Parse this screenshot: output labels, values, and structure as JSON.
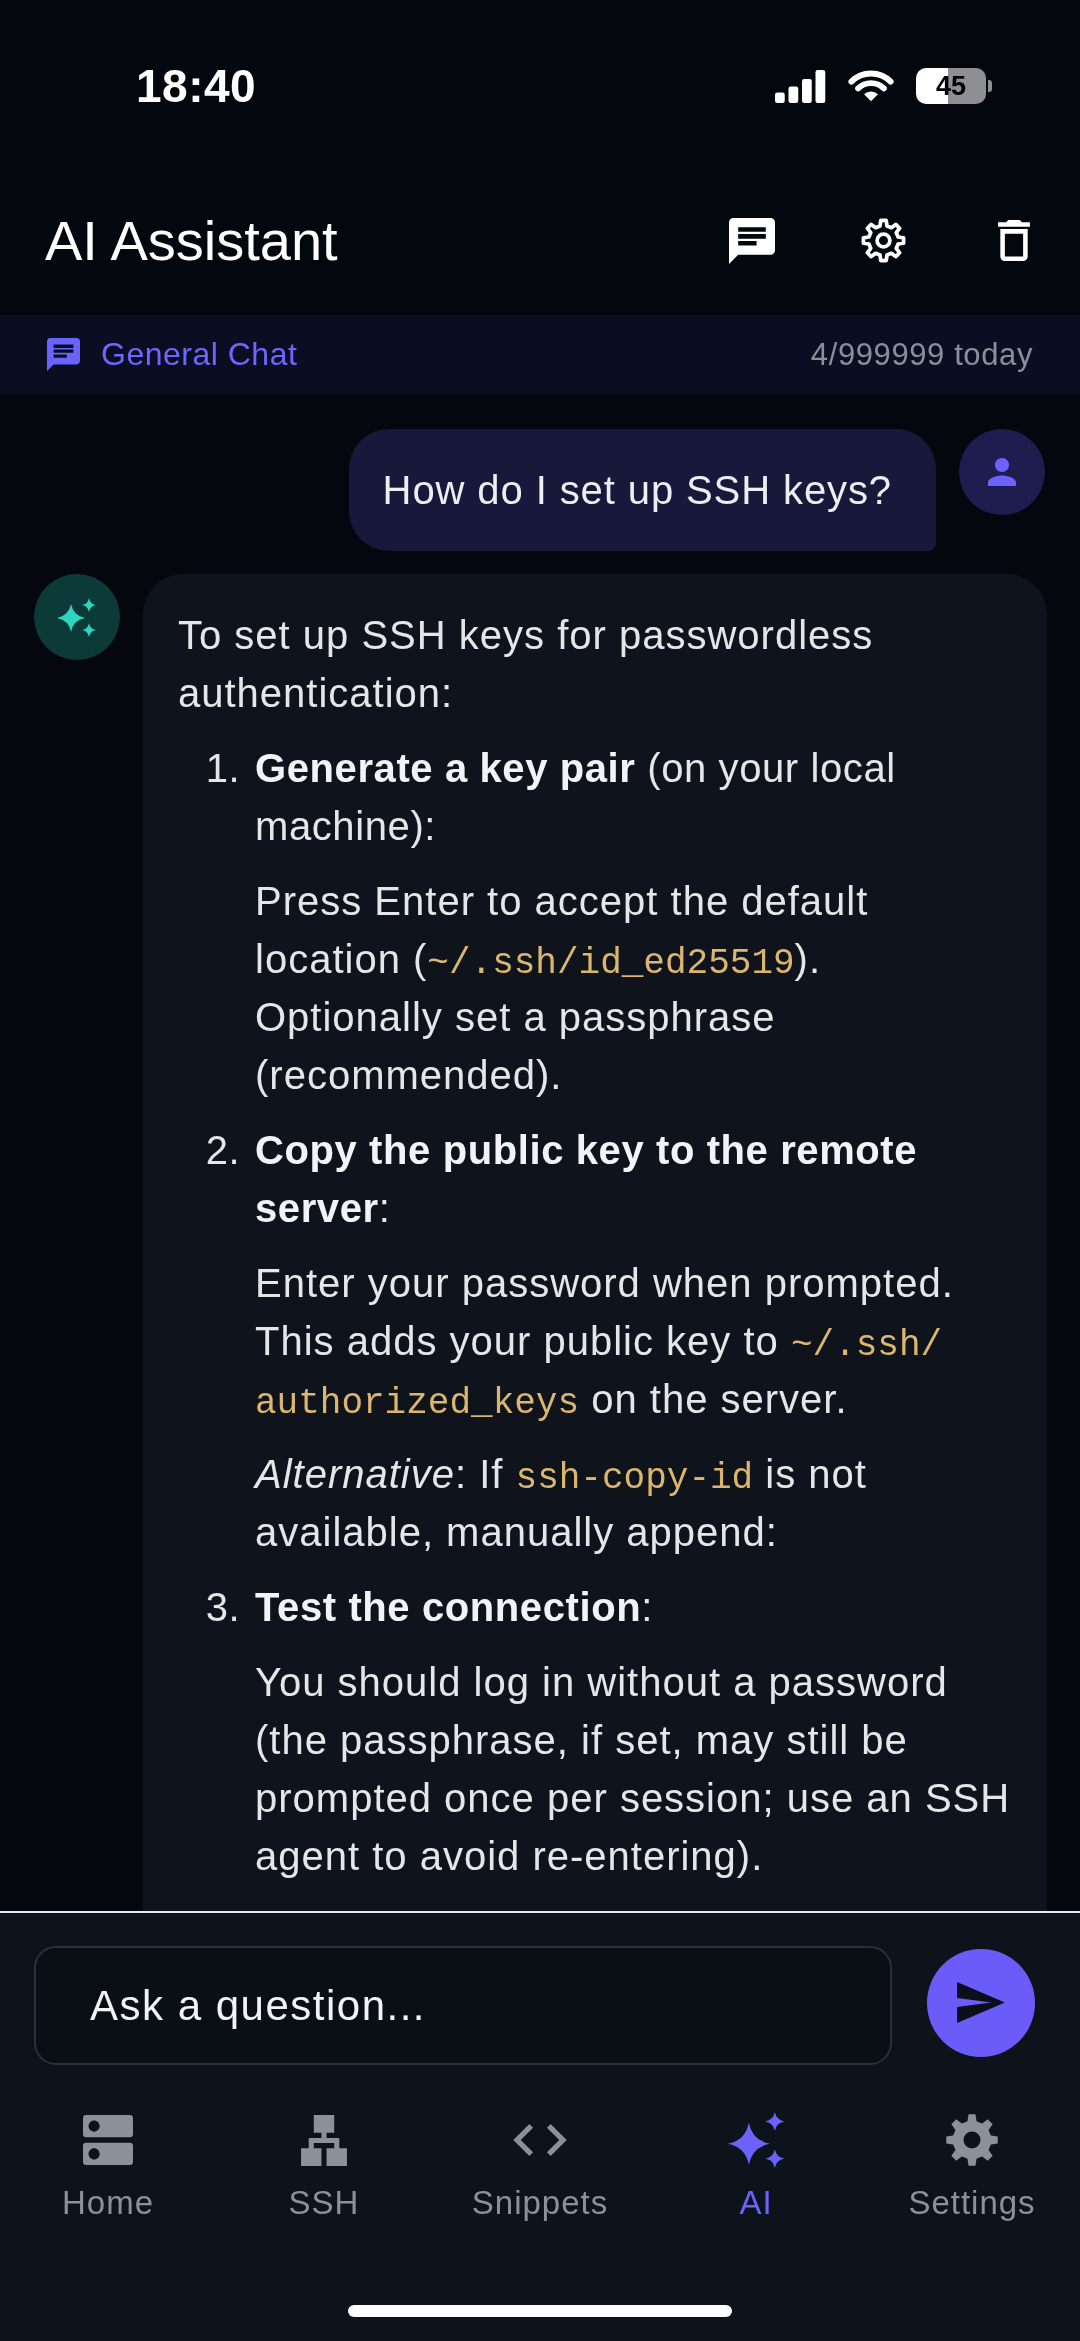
{
  "status_bar": {
    "time": "18:40",
    "battery": "45"
  },
  "header": {
    "title": "AI Assistant"
  },
  "chat_banner": {
    "name": "General Chat",
    "usage": "4/999999 today"
  },
  "messages": [
    {
      "kind": "user",
      "text": "How do I set up SSH keys?"
    },
    {
      "kind": "assistant",
      "intro": "To set up SSH keys for passwordless authentication:",
      "steps": [
        {
          "number": "1.",
          "title": "**Generate a key pair** (on your local machine):",
          "paragraphs": [
            [
              {
                "kind": "text",
                "text": "Press Enter to accept the default location ("
              },
              {
                "kind": "code",
                "text": "~/.ssh/id_ed25519"
              },
              {
                "kind": "text",
                "text": "). Optionally set a passphrase (recommended)."
              }
            ]
          ]
        },
        {
          "number": "2.",
          "title": "**Copy the public key to the remote server**:",
          "paragraphs": [
            [
              {
                "kind": "text",
                "text": "Enter your password when prompted. This adds your public key to "
              },
              {
                "kind": "code",
                "text": "~/.ssh/authorized_keys"
              },
              {
                "kind": "text",
                "text": " on the server."
              }
            ],
            [
              {
                "kind": "text",
                "text": "*Alternative*: If "
              },
              {
                "kind": "code",
                "text": "ssh-copy-id"
              },
              {
                "kind": "text",
                "text": " is not available, manually append:"
              }
            ]
          ]
        },
        {
          "number": "3.",
          "title": "**Test the connection**:",
          "paragraphs": [
            [
              {
                "kind": "text",
                "text": "You should log in without a password (the passphrase, if set, may still be prompted once per session; use an SSH agent to avoid re-entering)."
              }
            ]
          ]
        }
      ]
    }
  ],
  "composer": {
    "placeholder": "Ask a question..."
  },
  "nav": {
    "items": [
      {
        "label": "Home",
        "selected": false
      },
      {
        "label": "SSH",
        "selected": false
      },
      {
        "label": "Snippets",
        "selected": false
      },
      {
        "label": "AI",
        "selected": true
      },
      {
        "label": "Settings",
        "selected": false
      }
    ]
  }
}
